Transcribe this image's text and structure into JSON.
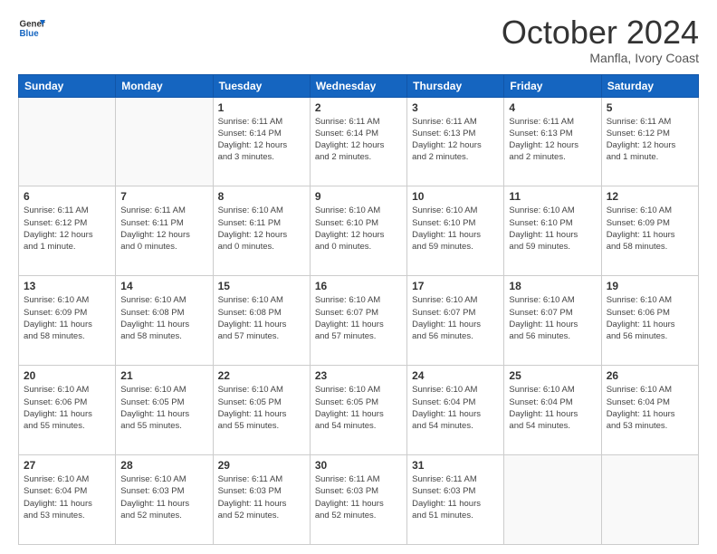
{
  "header": {
    "logo_line1": "General",
    "logo_line2": "Blue",
    "month": "October 2024",
    "location": "Manfla, Ivory Coast"
  },
  "weekdays": [
    "Sunday",
    "Monday",
    "Tuesday",
    "Wednesday",
    "Thursday",
    "Friday",
    "Saturday"
  ],
  "weeks": [
    [
      {
        "day": "",
        "info": ""
      },
      {
        "day": "",
        "info": ""
      },
      {
        "day": "1",
        "info": "Sunrise: 6:11 AM\nSunset: 6:14 PM\nDaylight: 12 hours\nand 3 minutes."
      },
      {
        "day": "2",
        "info": "Sunrise: 6:11 AM\nSunset: 6:14 PM\nDaylight: 12 hours\nand 2 minutes."
      },
      {
        "day": "3",
        "info": "Sunrise: 6:11 AM\nSunset: 6:13 PM\nDaylight: 12 hours\nand 2 minutes."
      },
      {
        "day": "4",
        "info": "Sunrise: 6:11 AM\nSunset: 6:13 PM\nDaylight: 12 hours\nand 2 minutes."
      },
      {
        "day": "5",
        "info": "Sunrise: 6:11 AM\nSunset: 6:12 PM\nDaylight: 12 hours\nand 1 minute."
      }
    ],
    [
      {
        "day": "6",
        "info": "Sunrise: 6:11 AM\nSunset: 6:12 PM\nDaylight: 12 hours\nand 1 minute."
      },
      {
        "day": "7",
        "info": "Sunrise: 6:11 AM\nSunset: 6:11 PM\nDaylight: 12 hours\nand 0 minutes."
      },
      {
        "day": "8",
        "info": "Sunrise: 6:10 AM\nSunset: 6:11 PM\nDaylight: 12 hours\nand 0 minutes."
      },
      {
        "day": "9",
        "info": "Sunrise: 6:10 AM\nSunset: 6:10 PM\nDaylight: 12 hours\nand 0 minutes."
      },
      {
        "day": "10",
        "info": "Sunrise: 6:10 AM\nSunset: 6:10 PM\nDaylight: 11 hours\nand 59 minutes."
      },
      {
        "day": "11",
        "info": "Sunrise: 6:10 AM\nSunset: 6:10 PM\nDaylight: 11 hours\nand 59 minutes."
      },
      {
        "day": "12",
        "info": "Sunrise: 6:10 AM\nSunset: 6:09 PM\nDaylight: 11 hours\nand 58 minutes."
      }
    ],
    [
      {
        "day": "13",
        "info": "Sunrise: 6:10 AM\nSunset: 6:09 PM\nDaylight: 11 hours\nand 58 minutes."
      },
      {
        "day": "14",
        "info": "Sunrise: 6:10 AM\nSunset: 6:08 PM\nDaylight: 11 hours\nand 58 minutes."
      },
      {
        "day": "15",
        "info": "Sunrise: 6:10 AM\nSunset: 6:08 PM\nDaylight: 11 hours\nand 57 minutes."
      },
      {
        "day": "16",
        "info": "Sunrise: 6:10 AM\nSunset: 6:07 PM\nDaylight: 11 hours\nand 57 minutes."
      },
      {
        "day": "17",
        "info": "Sunrise: 6:10 AM\nSunset: 6:07 PM\nDaylight: 11 hours\nand 56 minutes."
      },
      {
        "day": "18",
        "info": "Sunrise: 6:10 AM\nSunset: 6:07 PM\nDaylight: 11 hours\nand 56 minutes."
      },
      {
        "day": "19",
        "info": "Sunrise: 6:10 AM\nSunset: 6:06 PM\nDaylight: 11 hours\nand 56 minutes."
      }
    ],
    [
      {
        "day": "20",
        "info": "Sunrise: 6:10 AM\nSunset: 6:06 PM\nDaylight: 11 hours\nand 55 minutes."
      },
      {
        "day": "21",
        "info": "Sunrise: 6:10 AM\nSunset: 6:05 PM\nDaylight: 11 hours\nand 55 minutes."
      },
      {
        "day": "22",
        "info": "Sunrise: 6:10 AM\nSunset: 6:05 PM\nDaylight: 11 hours\nand 55 minutes."
      },
      {
        "day": "23",
        "info": "Sunrise: 6:10 AM\nSunset: 6:05 PM\nDaylight: 11 hours\nand 54 minutes."
      },
      {
        "day": "24",
        "info": "Sunrise: 6:10 AM\nSunset: 6:04 PM\nDaylight: 11 hours\nand 54 minutes."
      },
      {
        "day": "25",
        "info": "Sunrise: 6:10 AM\nSunset: 6:04 PM\nDaylight: 11 hours\nand 54 minutes."
      },
      {
        "day": "26",
        "info": "Sunrise: 6:10 AM\nSunset: 6:04 PM\nDaylight: 11 hours\nand 53 minutes."
      }
    ],
    [
      {
        "day": "27",
        "info": "Sunrise: 6:10 AM\nSunset: 6:04 PM\nDaylight: 11 hours\nand 53 minutes."
      },
      {
        "day": "28",
        "info": "Sunrise: 6:10 AM\nSunset: 6:03 PM\nDaylight: 11 hours\nand 52 minutes."
      },
      {
        "day": "29",
        "info": "Sunrise: 6:11 AM\nSunset: 6:03 PM\nDaylight: 11 hours\nand 52 minutes."
      },
      {
        "day": "30",
        "info": "Sunrise: 6:11 AM\nSunset: 6:03 PM\nDaylight: 11 hours\nand 52 minutes."
      },
      {
        "day": "31",
        "info": "Sunrise: 6:11 AM\nSunset: 6:03 PM\nDaylight: 11 hours\nand 51 minutes."
      },
      {
        "day": "",
        "info": ""
      },
      {
        "day": "",
        "info": ""
      }
    ]
  ]
}
